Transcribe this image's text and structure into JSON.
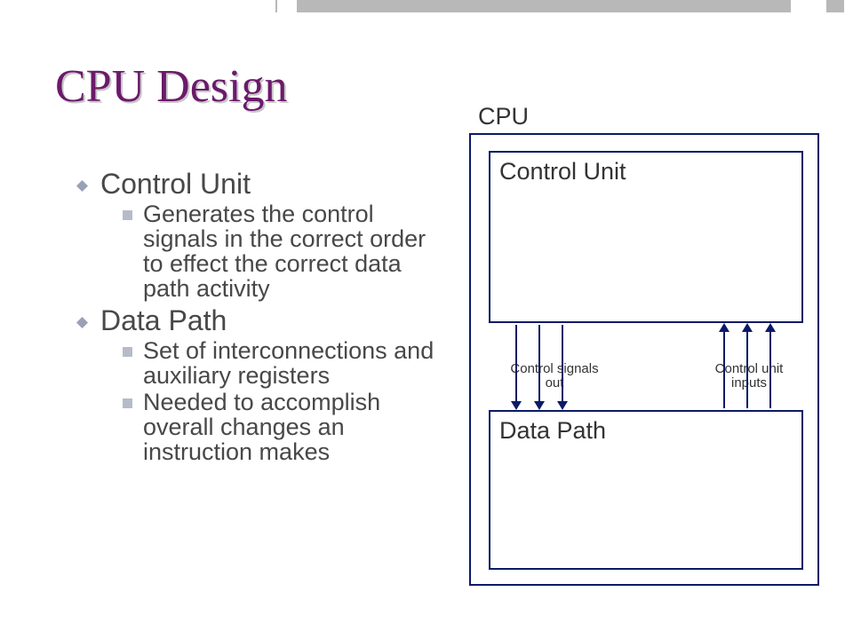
{
  "slide": {
    "title": "CPU Design",
    "bullets": {
      "b1": {
        "label": "Control Unit"
      },
      "b1_1": {
        "text": "Generates the control signals in the correct order to effect the correct data path activity"
      },
      "b2": {
        "label": "Data Path"
      },
      "b2_1": {
        "text": "Set of interconnections and auxiliary registers"
      },
      "b2_2": {
        "text": "Needed to accomplish overall changes  an instruction makes"
      }
    }
  },
  "diagram": {
    "cpu_label": "CPU",
    "control_unit_label": "Control Unit",
    "data_path_label": "Data Path",
    "signals_out_label": "Control signals out",
    "signals_in_label": "Control unit inputs"
  }
}
